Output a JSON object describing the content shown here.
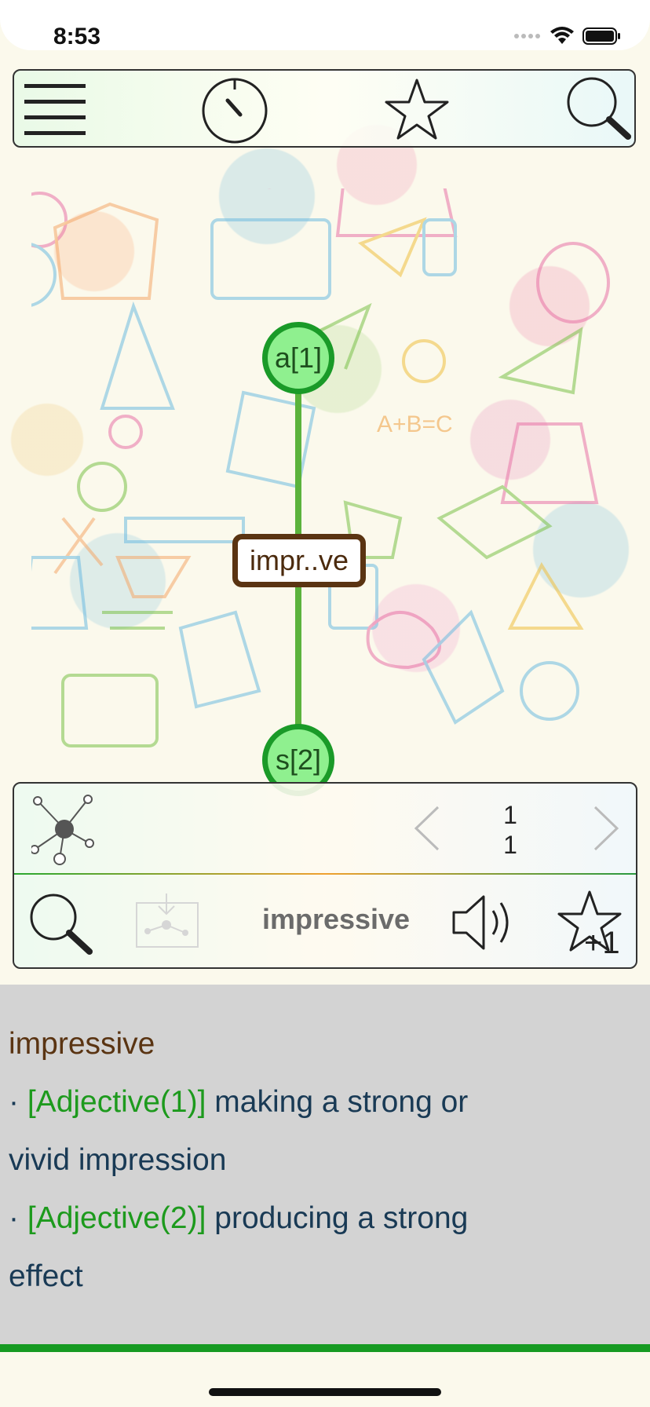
{
  "status_bar": {
    "time": "8:53"
  },
  "toolbar": {
    "menu_icon": "hamburger-menu-icon",
    "timer_icon": "timer-icon",
    "favorites_icon": "star-icon",
    "search_icon": "search-icon"
  },
  "graph": {
    "top_node": "a[1]",
    "center_node": "impr..ve",
    "bottom_node": "s[2]",
    "line_color": "#5bb33c",
    "node_fill": "#8ff08f",
    "node_border": "#1a9a28",
    "word_border": "#5a3412"
  },
  "panel": {
    "pagination": {
      "current": "1",
      "total": "1"
    },
    "word": "impressive"
  },
  "definition": {
    "title": "impressive",
    "entries": [
      {
        "bullet": "·",
        "tag": "[Adjective(1)]",
        "text_line1": "making a strong or",
        "text_line2": "vivid impression"
      },
      {
        "bullet": "·",
        "tag": "[Adjective(2)]",
        "text_line1": "producing a strong",
        "text_line2": "effect"
      }
    ]
  },
  "colors": {
    "definition_bg": "#d3d3d3",
    "title_color": "#5a3412",
    "tag_color": "#1d9a1d",
    "text_color": "#193a55",
    "accent_line": "#169a22"
  }
}
